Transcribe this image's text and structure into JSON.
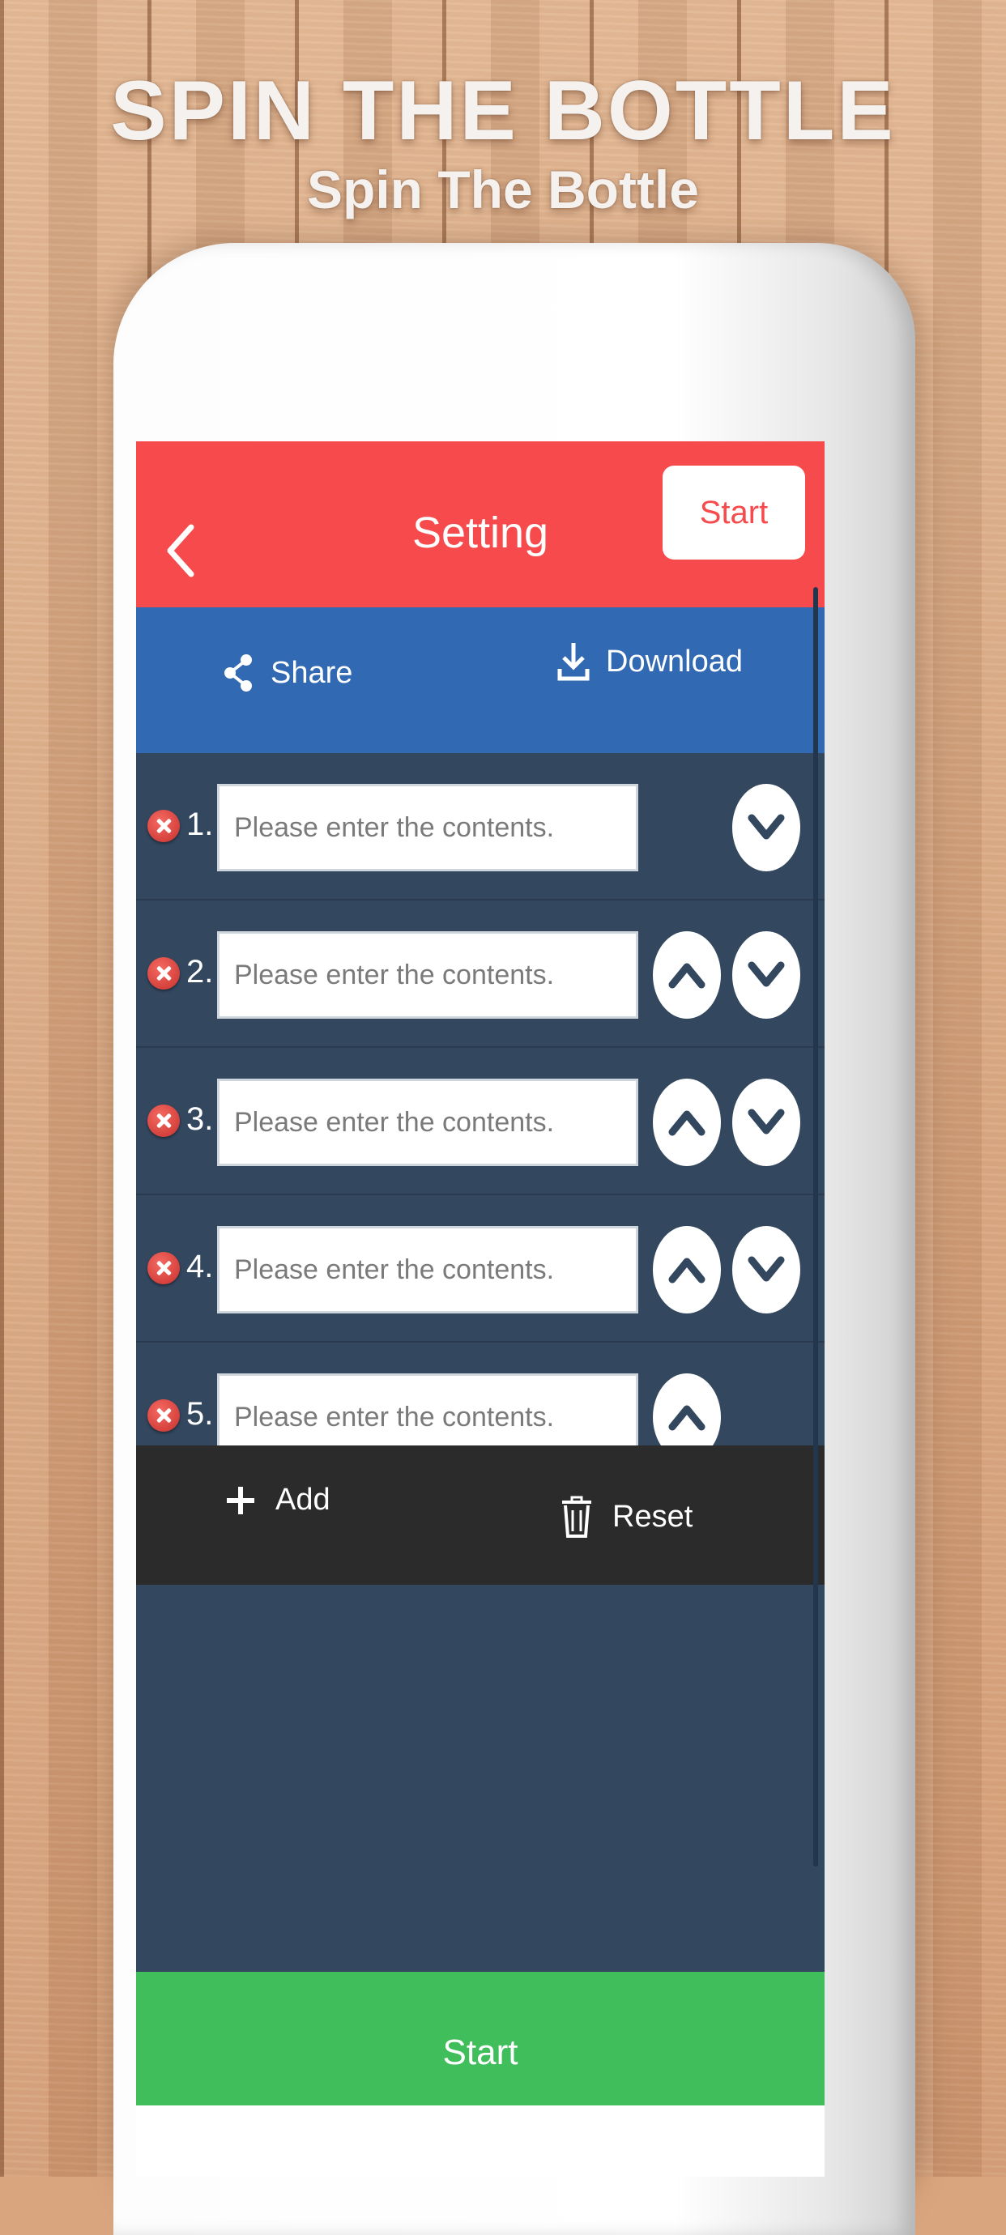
{
  "promo": {
    "title": "SPIN THE BOTTLE",
    "subtitle": "Spin The Bottle"
  },
  "navbar": {
    "back_icon": "chevron-left-icon",
    "title": "Setting",
    "start_label": "Start"
  },
  "actions": {
    "share_label": "Share",
    "share_icon": "share-icon",
    "download_label": "Download",
    "download_icon": "download-icon"
  },
  "items": [
    {
      "number": "1.",
      "value": "",
      "placeholder": "Please enter the contents.",
      "show_up": false,
      "show_down": true
    },
    {
      "number": "2.",
      "value": "",
      "placeholder": "Please enter the contents.",
      "show_up": true,
      "show_down": true
    },
    {
      "number": "3.",
      "value": "",
      "placeholder": "Please enter the contents.",
      "show_up": true,
      "show_down": true
    },
    {
      "number": "4.",
      "value": "",
      "placeholder": "Please enter the contents.",
      "show_up": true,
      "show_down": true
    },
    {
      "number": "5.",
      "value": "",
      "placeholder": "Please enter the contents.",
      "show_up": true,
      "show_down": false
    }
  ],
  "toolbar": {
    "add_label": "Add",
    "add_icon": "plus-icon",
    "reset_label": "Reset",
    "reset_icon": "trash-icon"
  },
  "footer": {
    "start_label": "Start"
  },
  "colors": {
    "nav_red": "#f74a4c",
    "action_blue": "#3269b3",
    "list_bg": "#33475f",
    "toolbar_dark": "#2b2b2b",
    "start_green": "#3fbe5b"
  }
}
